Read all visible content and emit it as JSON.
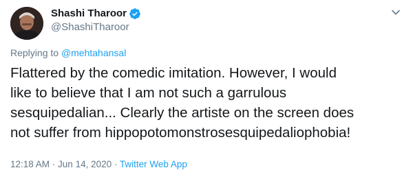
{
  "author": {
    "display_name": "Shashi Tharoor",
    "handle": "@ShashiTharoor",
    "verified": true
  },
  "reply": {
    "prefix": "Replying to ",
    "target": "@mehtahansal"
  },
  "tweet": {
    "lines": [
      "Flattered by the comedic imitation. However, I would",
      "like to believe that I am not such a garrulous",
      "sesquipedalian... Clearly the artiste on the screen does",
      "not suffer from hippopotomonstrosesquipedaliophobia!"
    ]
  },
  "meta": {
    "time": "12:18 AM",
    "sep1": " · ",
    "date": "Jun 14, 2020",
    "sep2": " · ",
    "source": "Twitter Web App"
  },
  "colors": {
    "accent": "#1da1f2",
    "secondary_text": "#657786",
    "primary_text": "#14171a"
  },
  "icons": {
    "verified": "verified-badge-icon",
    "more": "chevron-down-icon"
  }
}
